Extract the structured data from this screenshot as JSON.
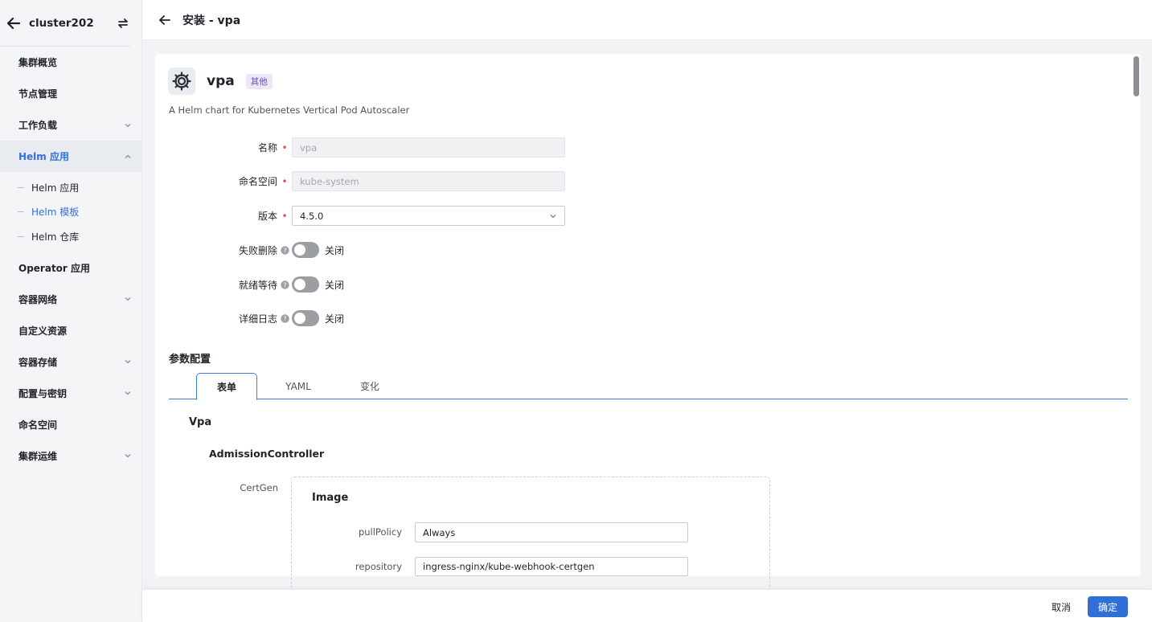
{
  "sidebar": {
    "cluster_name": "cluster202",
    "items": [
      {
        "label": "集群概览",
        "expandable": false
      },
      {
        "label": "节点管理",
        "expandable": false
      },
      {
        "label": "工作负载",
        "expandable": true
      },
      {
        "label": "Helm 应用",
        "expandable": true,
        "expanded": true,
        "active": true
      },
      {
        "label": "Operator 应用",
        "expandable": false
      },
      {
        "label": "容器网络",
        "expandable": true
      },
      {
        "label": "自定义资源",
        "expandable": false
      },
      {
        "label": "容器存储",
        "expandable": true
      },
      {
        "label": "配置与密钥",
        "expandable": true
      },
      {
        "label": "命名空间",
        "expandable": false
      },
      {
        "label": "集群运维",
        "expandable": true
      }
    ],
    "helm_sub_items": [
      {
        "label": "Helm 应用",
        "active": false
      },
      {
        "label": "Helm 模板",
        "active": true
      },
      {
        "label": "Helm 仓库",
        "active": false
      }
    ]
  },
  "header": {
    "title": "安装 - vpa"
  },
  "chart": {
    "name": "vpa",
    "category_badge": "其他",
    "description": "A Helm chart for Kubernetes Vertical Pod Autoscaler"
  },
  "form": {
    "name_label": "名称",
    "name_value": "vpa",
    "namespace_label": "命名空间",
    "namespace_value": "kube-system",
    "version_label": "版本",
    "version_value": "4.5.0",
    "fail_delete_label": "失败删除",
    "fail_delete_state": "关闭",
    "ready_wait_label": "就绪等待",
    "ready_wait_state": "关闭",
    "verbose_log_label": "详细日志",
    "verbose_log_state": "关闭"
  },
  "params": {
    "section_title": "参数配置",
    "tabs": [
      "表单",
      "YAML",
      "变化"
    ],
    "active_tab": "表单",
    "group_vpa": "Vpa",
    "group_admission": "AdmissionController",
    "certgen_label": "CertGen",
    "image_title": "Image",
    "pull_policy_label": "pullPolicy",
    "pull_policy_value": "Always",
    "repository_label": "repository",
    "repository_value": "ingress-nginx/kube-webhook-certgen"
  },
  "footer": {
    "cancel_label": "取消",
    "ok_label": "确定"
  },
  "colors": {
    "primary": "#2f6fd6",
    "active_text": "#3370d6",
    "sidebar_bg": "#f4f5f7",
    "required": "#e34d4d",
    "toggle_off": "#9b9ea3",
    "badge_bg": "#ece7f8"
  }
}
